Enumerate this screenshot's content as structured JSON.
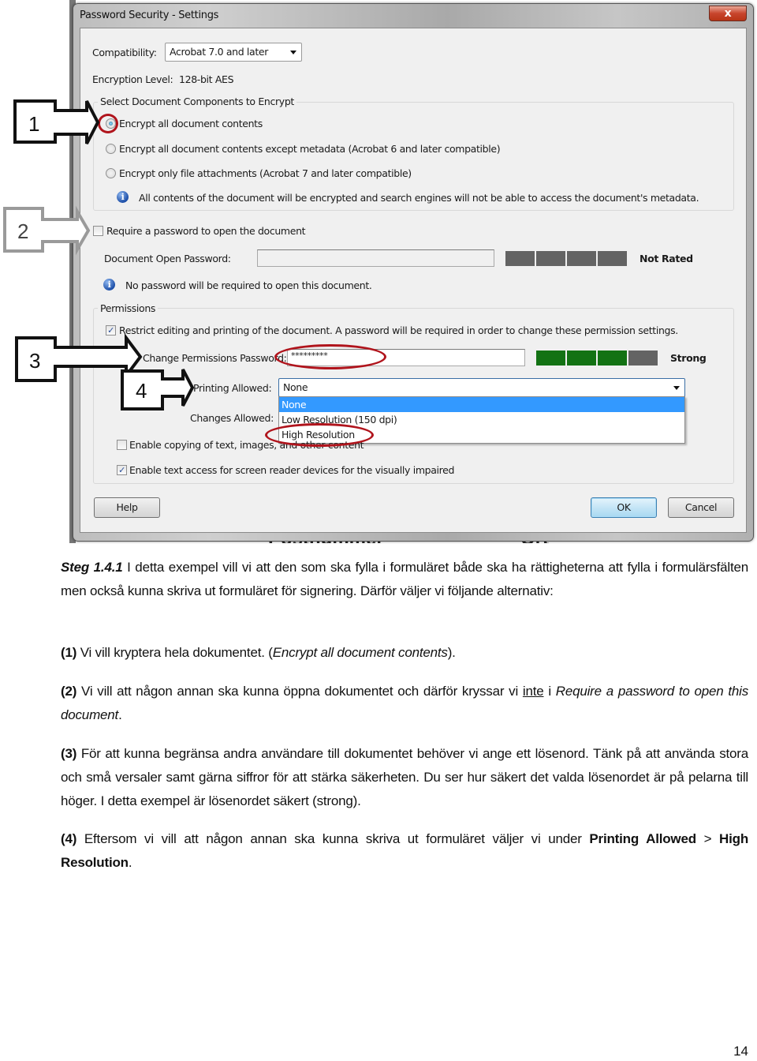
{
  "dialog": {
    "title": "Password Security - Settings",
    "close_label": "x",
    "compatibility": {
      "label": "Compatibility:",
      "value": "Acrobat 7.0 and later"
    },
    "encryption_level": {
      "label": "Encryption  Level:",
      "value": "128-bit AES"
    },
    "components_group": {
      "title": "Select Document Components to Encrypt",
      "options": [
        {
          "label": "Encrypt all document contents",
          "selected": true
        },
        {
          "label": "Encrypt all document contents except metadata (Acrobat 6 and later compatible)",
          "selected": false
        },
        {
          "label": "Encrypt only file attachments (Acrobat 7 and later compatible)",
          "selected": false
        }
      ],
      "info": "All contents of the document will be encrypted and search engines will not be able to access the document's metadata."
    },
    "open_password": {
      "checkbox_label": "Require a password to open the document",
      "checked": false,
      "field_label": "Document Open Password:",
      "value": "",
      "strength_label": "Not Rated",
      "strength_filled": 0,
      "strength_total": 4,
      "info": "No password will be required to open this document."
    },
    "permissions": {
      "title": "Permissions",
      "restrict_label": "Restrict editing and printing of the document. A password will be required in order to change these permission settings.",
      "restrict_checked": true,
      "password_label": "Change Permissions Password:",
      "password_value": "*********",
      "strength_label": "Strong",
      "strength_filled": 3,
      "strength_total": 4,
      "printing_label": "Printing Allowed:",
      "printing_value": "None",
      "printing_options": [
        "None",
        "Low Resolution (150 dpi)",
        "High Resolution"
      ],
      "printing_highlighted": "None",
      "changes_label": "Changes Allowed:",
      "copy_label": "Enable copying of text, images, and other content",
      "copy_checked": false,
      "screenreader_label": "Enable text access for screen reader devices for the visually impaired",
      "screenreader_checked": true
    },
    "buttons": {
      "help": "Help",
      "ok": "OK",
      "cancel": "Cancel"
    },
    "colors": {
      "meter_on": "#137214",
      "meter_off": "#636363",
      "highlight": "#3399ff",
      "annotation_ring": "#b0141c"
    }
  },
  "background_text": {
    "left": "Postnummer",
    "right": "Ort"
  },
  "callouts": [
    "1",
    "2",
    "3",
    "4"
  ],
  "document": {
    "step_label": "Steg 1.4.1",
    "intro": " I detta exempel vill vi att den som ska fylla i formuläret både ska ha rättigheterna att fylla i formulärsfälten men också kunna skriva ut formuläret för signering. Därför väljer vi följande alternativ:",
    "item1": {
      "num": "(1)",
      "text": " Vi vill kryptera hela dokumentet. (",
      "italic": "Encrypt all document contents",
      "end": ")."
    },
    "item2": {
      "num": "(2)",
      "text": " Vi vill att någon annan ska kunna öppna dokumentet och därför kryssar vi ",
      "underline": "inte",
      "mid": " i ",
      "italic": "Require a password to open this document",
      "end": "."
    },
    "item3": {
      "num": "(3)",
      "text": " För att kunna begränsa andra användare till dokumentet behöver vi ange ett lösenord. Tänk på att använda stora och små versaler samt gärna siffror för att stärka säkerheten. Du ser hur säkert det valda lösenordet är på pelarna till höger. I detta exempel är lösenordet säkert (strong)."
    },
    "item4": {
      "num": "(4)",
      "text": " Eftersom vi vill att någon annan ska kunna skriva ut formuläret väljer vi under ",
      "bold1": "Printing Allowed",
      "mid": " > ",
      "bold2": "High Resolution",
      "end": "."
    },
    "page_number": "14"
  }
}
